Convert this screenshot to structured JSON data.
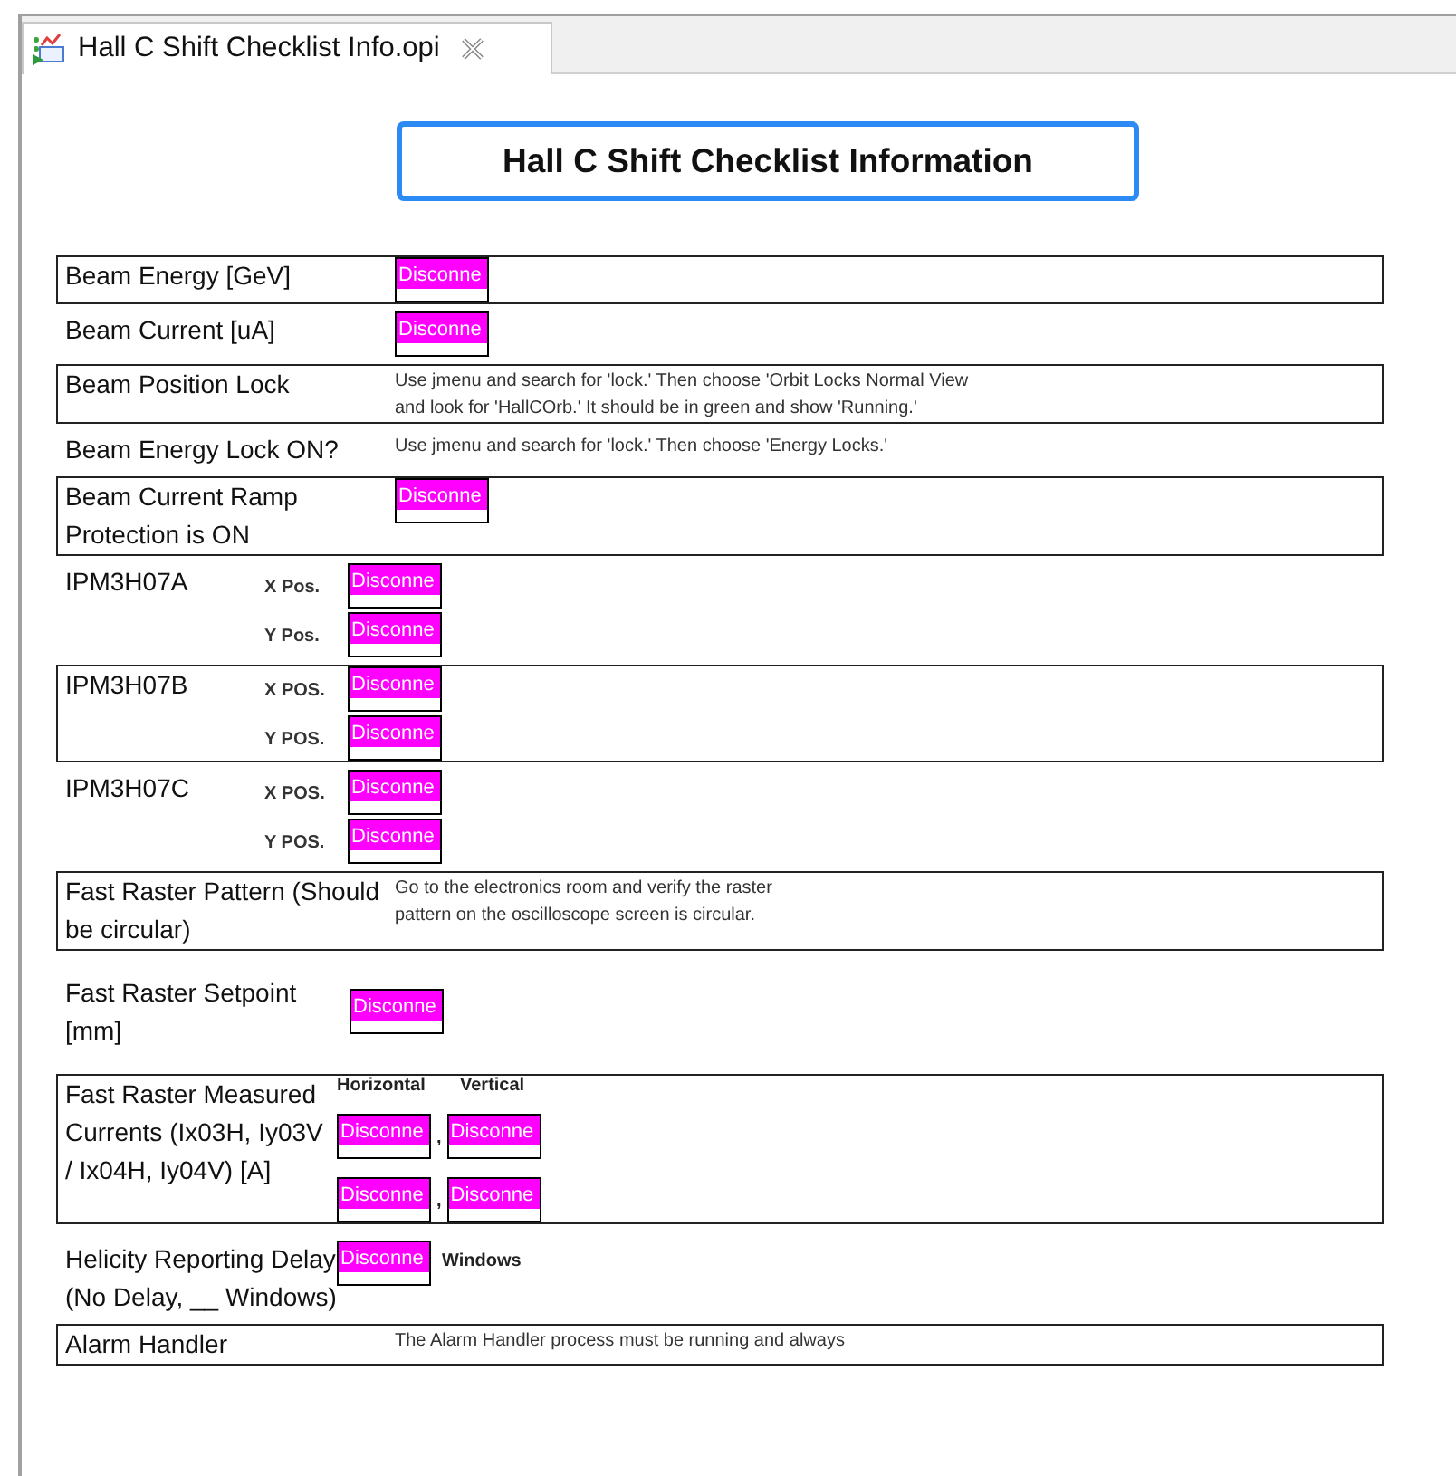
{
  "tab": {
    "title": "Hall C Shift Checklist Info.opi",
    "selected": true
  },
  "heading": "Hall C Shift Checklist Information",
  "rows": [
    {
      "kind": "reading",
      "label": "Beam Energy [GeV]",
      "boxed": true,
      "value": "Disconne"
    },
    {
      "kind": "reading",
      "label": "Beam Current [uA]",
      "boxed": false,
      "value": "Disconne"
    },
    {
      "kind": "note",
      "label": "Beam Position Lock",
      "boxed": true,
      "lines": [
        "Use jmenu and search for 'lock.' Then choose 'Orbit Locks Normal View",
        "and look for 'HallCOrb.' It should be in green and show 'Running.'"
      ]
    },
    {
      "kind": "note",
      "label": "Beam Energy Lock ON?",
      "boxed": false,
      "lines": [
        "Use jmenu and search for 'lock.' Then choose 'Energy Locks.'"
      ]
    },
    {
      "kind": "reading",
      "label": "Beam Current Ramp Protection is ON",
      "boxed": true,
      "value": "Disconne"
    },
    {
      "kind": "positions",
      "label": "IPM3H07A",
      "boxed": false,
      "positions": [
        {
          "axis": "X Pos.",
          "value": "Disconne"
        },
        {
          "axis": "Y Pos.",
          "value": "Disconne"
        }
      ]
    },
    {
      "kind": "positions",
      "label": "IPM3H07B",
      "boxed": true,
      "positions": [
        {
          "axis": "X POS.",
          "value": "Disconne"
        },
        {
          "axis": "Y POS.",
          "value": "Disconne"
        }
      ]
    },
    {
      "kind": "positions",
      "label": "IPM3H07C",
      "boxed": false,
      "positions": [
        {
          "axis": "X POS.",
          "value": "Disconne"
        },
        {
          "axis": "Y POS.",
          "value": "Disconne"
        }
      ]
    },
    {
      "kind": "note",
      "label": "Fast Raster Pattern (Should be circular)",
      "boxed": true,
      "lines": [
        "Go to the electronics room and verify the raster",
        "pattern on the oscilloscope screen is circular."
      ]
    },
    {
      "kind": "setpoint",
      "label": "Fast Raster Setpoint [mm]",
      "boxed": false,
      "value": "Disconne"
    },
    {
      "kind": "grid",
      "label": "Fast Raster Measured Currents (Ix03H, Iy03V / Ix04H, Iy04V) [A]",
      "boxed": true,
      "headers": [
        "Horizontal",
        "Vertical"
      ],
      "separator": ",",
      "cells": [
        [
          "Disconne",
          "Disconne"
        ],
        [
          "Disconne",
          "Disconne"
        ]
      ]
    },
    {
      "kind": "suffixed",
      "label": "Helicity Reporting Delay (No Delay, __ Windows)",
      "boxed": false,
      "value": "Disconne",
      "suffix": "Windows"
    },
    {
      "kind": "note",
      "label": "Alarm Handler",
      "boxed": true,
      "lines": [
        "The Alarm Handler process must be running and always"
      ]
    }
  ]
}
